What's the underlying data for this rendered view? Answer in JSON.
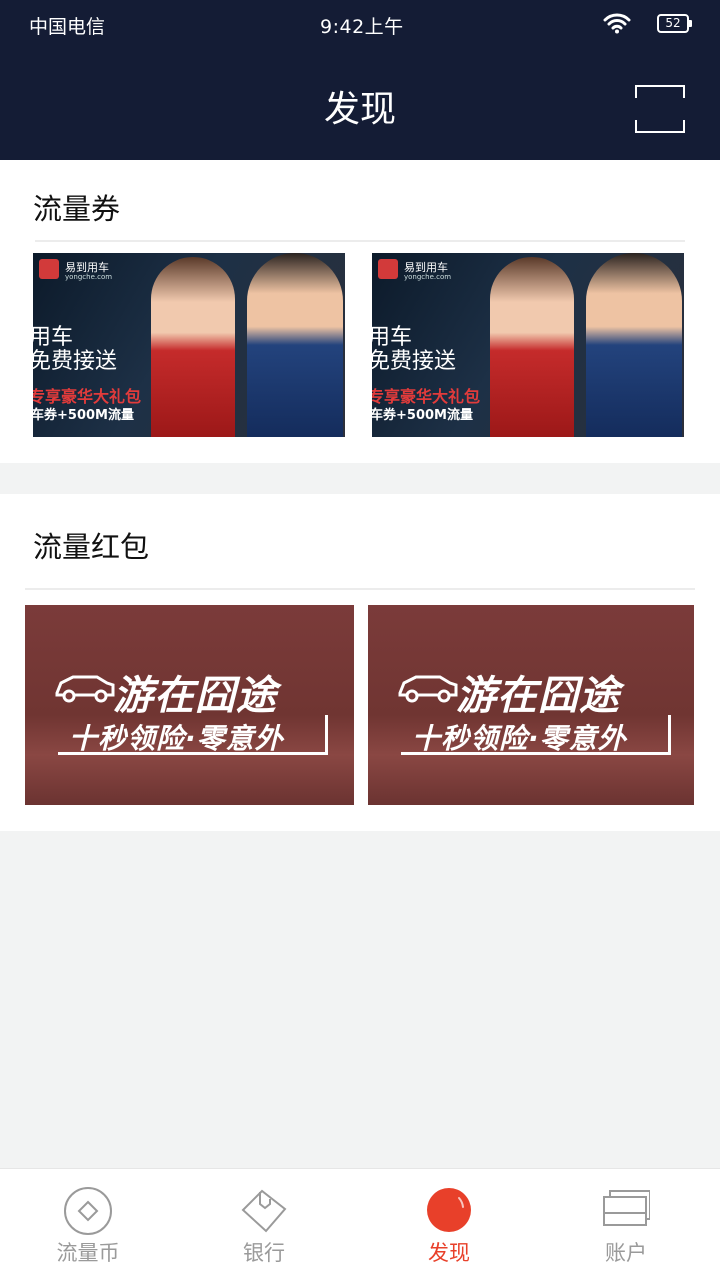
{
  "status_bar": {
    "carrier": "中国电信",
    "time": "9:42上午",
    "battery": "52"
  },
  "header": {
    "title": "发现",
    "scan_icon": "scan-icon"
  },
  "sections": [
    {
      "title": "流量券",
      "banners": [
        {
          "brand": "易到用车",
          "brand_sub": "yongche.com",
          "line1": "用车",
          "line2": "免费接送",
          "line3": "专享豪华大礼包",
          "line4": "车券+500M流量"
        },
        {
          "brand": "易到用车",
          "brand_sub": "yongche.com",
          "line1": "用车",
          "line2": "免费接送",
          "line3": "专享豪华大礼包",
          "line4": "车券+500M流量"
        }
      ]
    },
    {
      "title": "流量红包",
      "banners": [
        {
          "title": "游在囧途",
          "subtitle": "十秒领险·零意外"
        },
        {
          "title": "游在囧途",
          "subtitle": "十秒领险·零意外"
        }
      ]
    }
  ],
  "bottom_nav": [
    {
      "label": "流量币",
      "icon": "coin-icon",
      "active": false
    },
    {
      "label": "银行",
      "icon": "tag-icon",
      "active": false
    },
    {
      "label": "发现",
      "icon": "discover-icon",
      "active": true
    },
    {
      "label": "账户",
      "icon": "cards-icon",
      "active": false
    }
  ],
  "colors": {
    "header_bg": "#141c35",
    "accent": "#e8402a",
    "inactive": "#9a9a9a",
    "page_bg": "#f2f3f3"
  }
}
